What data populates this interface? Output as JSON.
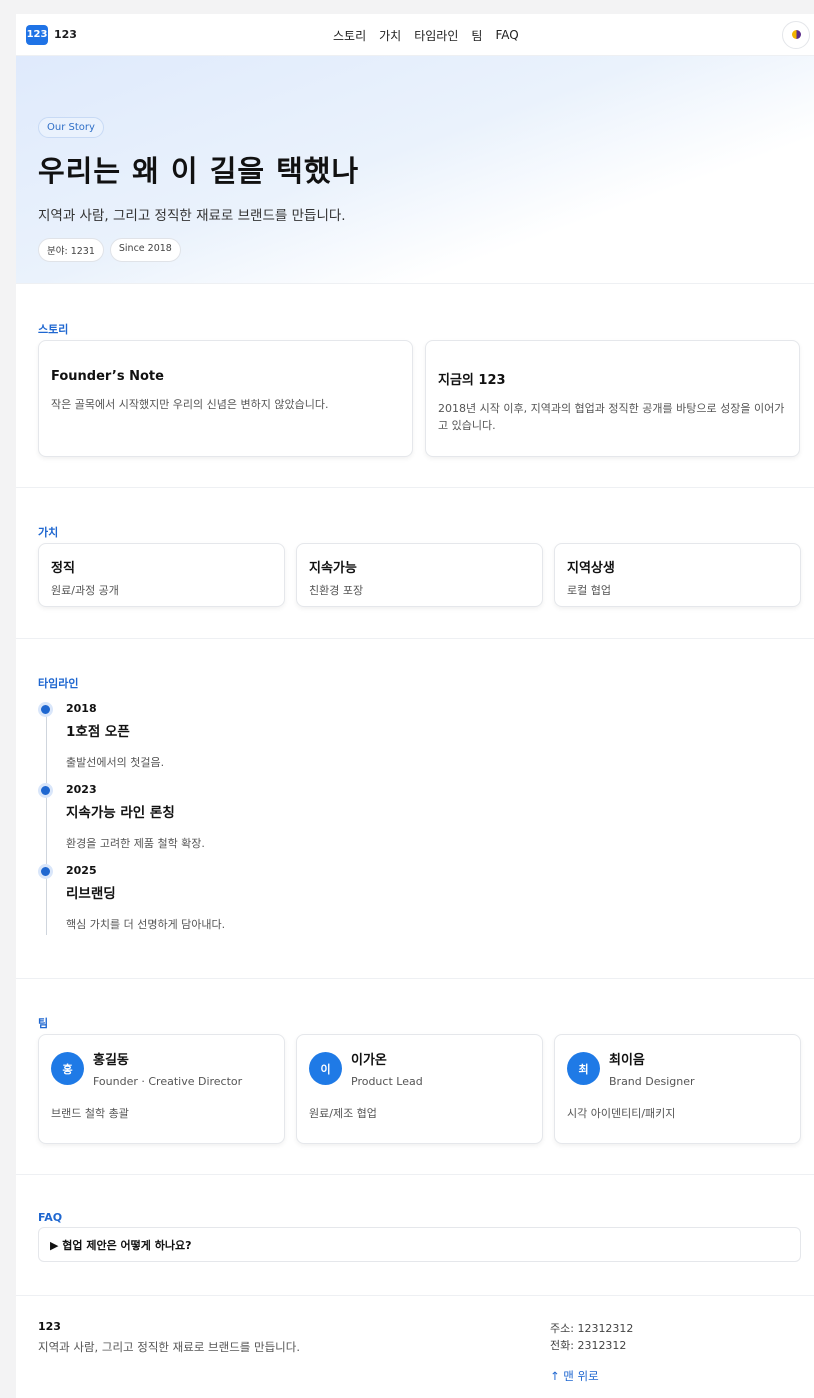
{
  "brand": {
    "badge": "123",
    "name": "123"
  },
  "nav": [
    "스토리",
    "가치",
    "타임라인",
    "팀",
    "FAQ"
  ],
  "hero": {
    "pill": "Our Story",
    "title": "우리는 왜 이 길을 택했나",
    "lead": "지역과 사람, 그리고 정직한 재료로 브랜드를 만듭니다.",
    "chips": [
      "분야: 1231",
      "Since 2018"
    ]
  },
  "story": {
    "title": "스토리",
    "cards": [
      {
        "title": "Founder’s Note",
        "text": "작은 골목에서 시작했지만 우리의 신념은 변하지 않았습니다."
      },
      {
        "title": "지금의 123",
        "text": "2018년 시작 이후, 지역과의 협업과 정직한 공개를 바탕으로 성장을 이어가고 있습니다."
      }
    ]
  },
  "values": {
    "title": "가치",
    "cards": [
      {
        "title": "정직",
        "text": "원료/과정 공개"
      },
      {
        "title": "지속가능",
        "text": "친환경 포장"
      },
      {
        "title": "지역상생",
        "text": "로컬 협업"
      }
    ]
  },
  "timeline": {
    "title": "타임라인",
    "items": [
      {
        "year": "2018",
        "title": "1호점 오픈",
        "text": "출발선에서의 첫걸음."
      },
      {
        "year": "2023",
        "title": "지속가능 라인 론칭",
        "text": "환경을 고려한 제품 철학 확장."
      },
      {
        "year": "2025",
        "title": "리브랜딩",
        "text": "핵심 가치를 더 선명하게 담아내다."
      }
    ]
  },
  "team": {
    "title": "팀",
    "members": [
      {
        "initial": "홍",
        "name": "홍길동",
        "role": "Founder · Creative Director",
        "text": "브랜드 철학 총괄"
      },
      {
        "initial": "이",
        "name": "이가온",
        "role": "Product Lead",
        "text": "원료/제조 협업"
      },
      {
        "initial": "최",
        "name": "최이음",
        "role": "Brand Designer",
        "text": "시각 아이덴티티/패키지"
      }
    ]
  },
  "faq": {
    "title": "FAQ",
    "items": [
      "▶ 협업 제안은 어떻게 하나요?"
    ]
  },
  "footer": {
    "name": "123",
    "tagline": "지역과 사람, 그리고 정직한 재료로 브랜드를 만듭니다.",
    "address": "주소: 12312312",
    "phone": "전화: 2312312",
    "top_link": "↑ 맨 위로"
  },
  "colors": {
    "accent": "#1f67d0",
    "avatar": "#1f7ae6"
  },
  "icons": {
    "theme_toggle": "half-moon-icon",
    "timeline_marker": "dot-icon"
  }
}
